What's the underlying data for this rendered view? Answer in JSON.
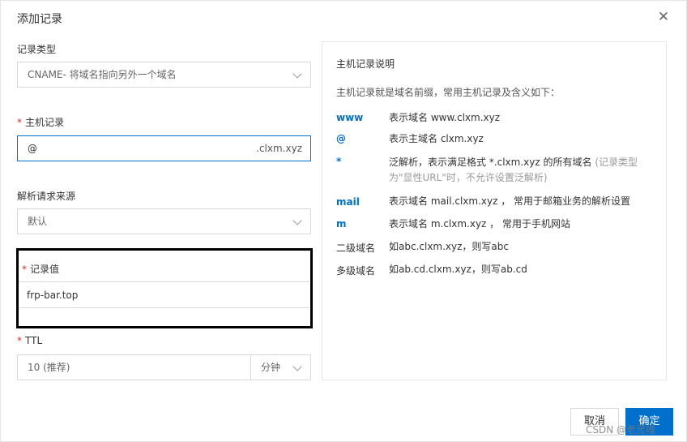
{
  "dialog": {
    "title": "添加记录"
  },
  "record_type": {
    "label": "记录类型",
    "value": "CNAME- 将域名指向另外一个域名"
  },
  "host_record": {
    "label": "主机记录",
    "value": "@",
    "suffix": ".clxm.xyz"
  },
  "resolve_source": {
    "label": "解析请求来源",
    "value": "默认"
  },
  "record_value": {
    "label": "记录值",
    "value": "frp-bar.top"
  },
  "ttl": {
    "label": "TTL",
    "value": "10 (推荐)",
    "unit": "分钟"
  },
  "help": {
    "title": "主机记录说明",
    "intro": "主机记录就是域名前缀，常用主机记录及含义如下：",
    "rows": [
      {
        "key": "www",
        "desc": "表示域名 www.clxm.xyz"
      },
      {
        "key": "@",
        "desc": "表示主域名 clxm.xyz"
      },
      {
        "key": "*",
        "desc": "泛解析，表示满足格式 *.clxm.xyz 的所有域名",
        "note": "(记录类型为\"显性URL\"时，不允许设置泛解析)"
      },
      {
        "key": "mail",
        "desc": "表示域名 mail.clxm.xyz ， 常用于邮箱业务的解析设置"
      },
      {
        "key": "m",
        "desc": "表示域名 m.clxm.xyz ， 常用于手机网站"
      },
      {
        "key": "二级域名",
        "desc": "如abc.clxm.xyz，则写abc"
      },
      {
        "key": "多级域名",
        "desc": "如ab.cd.clxm.xyz，则写ab.cd"
      }
    ]
  },
  "buttons": {
    "cancel": "取消",
    "ok": "确定"
  },
  "watermark": "CSDN @老灵魂",
  "colors": {
    "accent": "#0070cc",
    "required": "#d93026"
  }
}
